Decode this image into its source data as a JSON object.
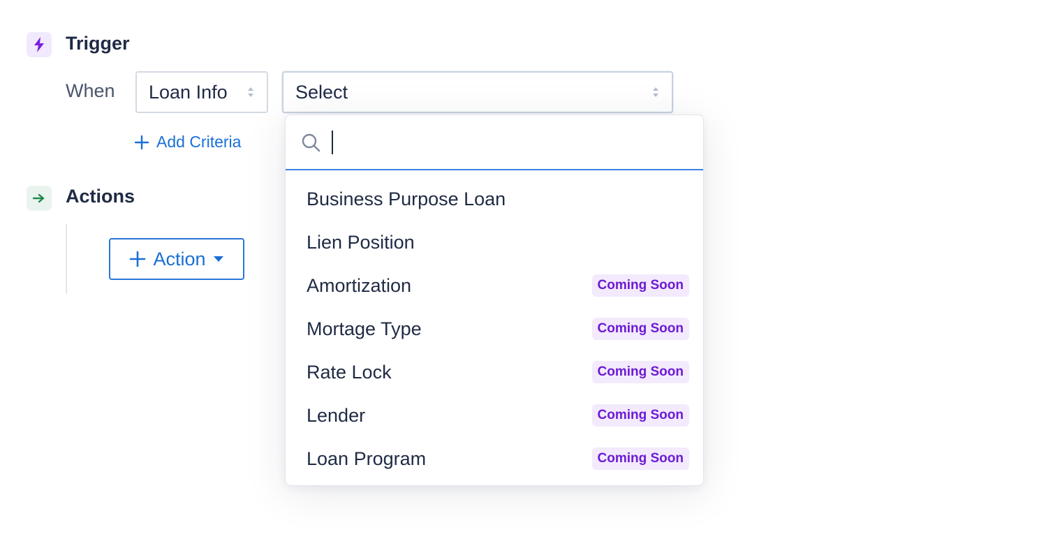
{
  "trigger": {
    "title": "Trigger",
    "icon": "lightning-icon",
    "icon_color": "#7b1fe0"
  },
  "condition": {
    "when_label": "When",
    "category_select": {
      "value": "Loan Info"
    },
    "field_select": {
      "value": "Select"
    }
  },
  "add_criteria": {
    "label": "Add Criteria",
    "color": "#1a6fd6"
  },
  "actions": {
    "title": "Actions",
    "icon": "arrow-right-icon",
    "icon_color": "#1f8a4c",
    "button_label": "Action"
  },
  "dropdown": {
    "search": {
      "value": "",
      "placeholder": ""
    },
    "options": [
      {
        "label": "Business Purpose Loan",
        "badge": ""
      },
      {
        "label": "Lien Position",
        "badge": ""
      },
      {
        "label": "Amortization",
        "badge": "Coming Soon"
      },
      {
        "label": "Mortage Type",
        "badge": "Coming Soon"
      },
      {
        "label": "Rate Lock",
        "badge": "Coming Soon"
      },
      {
        "label": "Lender",
        "badge": "Coming Soon"
      },
      {
        "label": "Loan Program",
        "badge": "Coming Soon"
      }
    ]
  },
  "colors": {
    "accent": "#1a6fd6",
    "badge_text": "#6d1bd3",
    "badge_bg": "#f3eafd",
    "text": "#1f2a44"
  }
}
